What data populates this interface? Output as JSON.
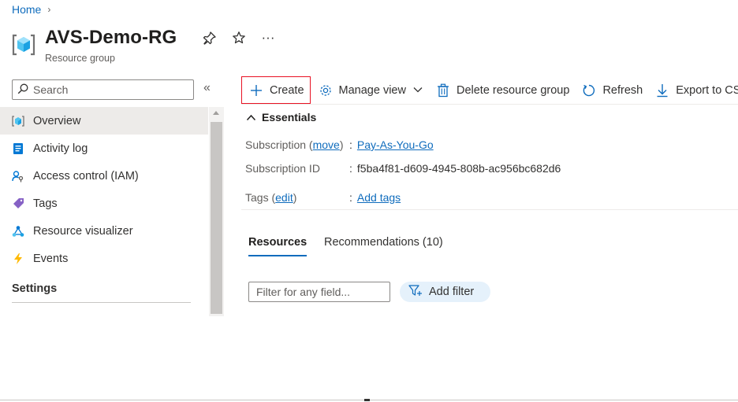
{
  "breadcrumb": {
    "home": "Home",
    "separator": "›"
  },
  "header": {
    "title": "AVS-Demo-RG",
    "subtitle": "Resource group",
    "icons": [
      "resource-group-icon",
      "pin-icon",
      "star-icon",
      "more-icon"
    ],
    "more": "···"
  },
  "sidebar": {
    "search_placeholder": "Search",
    "collapse": "«",
    "items": [
      {
        "label": "Overview",
        "icon": "overview-icon",
        "active": true
      },
      {
        "label": "Activity log",
        "icon": "activity-log-icon"
      },
      {
        "label": "Access control (IAM)",
        "icon": "iam-icon"
      },
      {
        "label": "Tags",
        "icon": "tag-icon"
      },
      {
        "label": "Resource visualizer",
        "icon": "visualizer-icon"
      },
      {
        "label": "Events",
        "icon": "lightning-icon"
      }
    ],
    "section": "Settings"
  },
  "toolbar": {
    "create": "Create",
    "manage_view": "Manage view",
    "delete": "Delete resource group",
    "refresh": "Refresh",
    "export": "Export to CSV"
  },
  "essentials": {
    "heading": "Essentials",
    "subscription_label": "Subscription",
    "move_link": "move",
    "subscription_value": "Pay-As-You-Go",
    "subscription_id_label": "Subscription ID",
    "subscription_id_value": "f5ba4f81-d609-4945-808b-ac956bc682d6",
    "tags_label": "Tags",
    "edit_link": "edit",
    "tags_value": "Add tags"
  },
  "tabs": [
    {
      "label": "Resources",
      "active": true
    },
    {
      "label": "Recommendations (10)"
    }
  ],
  "filter": {
    "placeholder": "Filter for any field...",
    "add_filter": "Add filter"
  },
  "colors": {
    "accent": "#0f6cbd",
    "create_border": "#e81123",
    "active_nav_bg": "#edebe9",
    "add_filter_bg": "#e5f1fb"
  }
}
